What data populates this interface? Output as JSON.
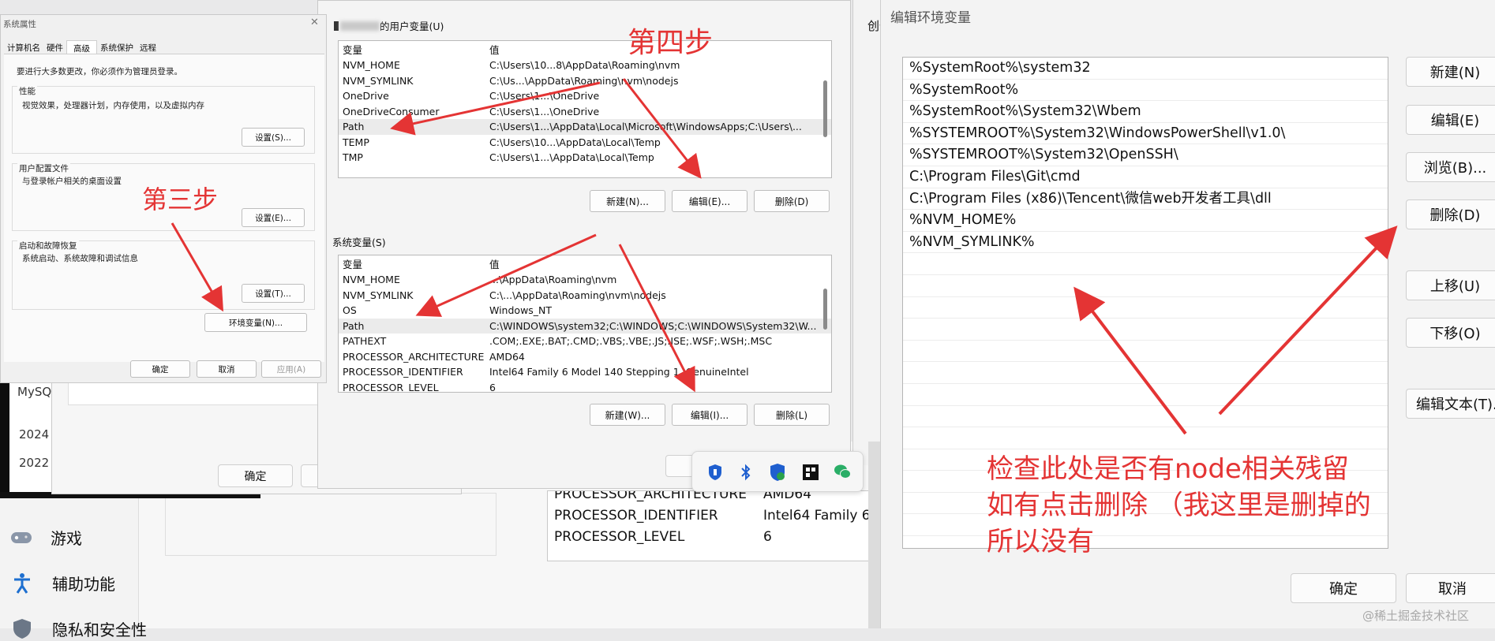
{
  "background": {
    "settings_sidebar": [
      {
        "icon": "gamepad-icon",
        "label": "游戏"
      },
      {
        "icon": "accessibility-icon",
        "label": "辅助功能"
      },
      {
        "icon": "shield-icon",
        "label": "隐私和安全性"
      }
    ],
    "left_fragments": [
      "MySQ",
      "2024",
      "2022"
    ],
    "behind_ok": "确定",
    "create_label": "创作",
    "behind_table": [
      {
        "name": "PROCESSOR_ARCHITECTURE",
        "value": "AMD64"
      },
      {
        "name": "PROCESSOR_IDENTIFIER",
        "value": "Intel64 Family 6 I"
      },
      {
        "name": "PROCESSOR_LEVEL",
        "value": "6"
      }
    ]
  },
  "sysprops": {
    "title": "系统属性",
    "tabs": [
      "计算机名",
      "硬件",
      "高级",
      "系统保护",
      "远程"
    ],
    "admin_note": "要进行大多数更改，你必须作为管理员登录。",
    "perf": {
      "title": "性能",
      "desc": "视觉效果，处理器计划，内存使用，以及虚拟内存",
      "button": "设置(S)..."
    },
    "profile": {
      "title": "用户配置文件",
      "desc": "与登录帐户相关的桌面设置",
      "button": "设置(E)..."
    },
    "startup": {
      "title": "启动和故障恢复",
      "desc": "系统启动、系统故障和调试信息",
      "button": "设置(T)..."
    },
    "env_button": "环境变量(N)...",
    "ok": "确定",
    "cancel": "取消",
    "apply": "应用(A)"
  },
  "envvars": {
    "user_label_suffix": "的用户变量(U)",
    "col_var": "变量",
    "col_val": "值",
    "user_vars": [
      {
        "name": "NVM_HOME",
        "value": "C:\\Users\\10...8\\AppData\\Roaming\\nvm"
      },
      {
        "name": "NVM_SYMLINK",
        "value": "C:\\Us...\\AppData\\Roaming\\nvm\\nodejs"
      },
      {
        "name": "OneDrive",
        "value": "C:\\Users\\1...\\OneDrive"
      },
      {
        "name": "OneDriveConsumer",
        "value": "C:\\Users\\1...\\OneDrive"
      },
      {
        "name": "Path",
        "value": "C:\\Users\\1...\\AppData\\Local\\Microsoft\\WindowsApps;C:\\Users\\..."
      },
      {
        "name": "TEMP",
        "value": "C:\\Users\\10...\\AppData\\Local\\Temp"
      },
      {
        "name": "TMP",
        "value": "C:\\Users\\1...\\AppData\\Local\\Temp"
      }
    ],
    "user_buttons": [
      "新建(N)...",
      "编辑(E)...",
      "删除(D)"
    ],
    "sys_label": "系统变量(S)",
    "sys_vars": [
      {
        "name": "NVM_HOME",
        "value": "...\\AppData\\Roaming\\nvm"
      },
      {
        "name": "NVM_SYMLINK",
        "value": "C:\\...\\AppData\\Roaming\\nvm\\nodejs"
      },
      {
        "name": "OS",
        "value": "Windows_NT"
      },
      {
        "name": "Path",
        "value": "C:\\WINDOWS\\system32;C:\\WINDOWS;C:\\WINDOWS\\System32\\W..."
      },
      {
        "name": "PATHEXT",
        "value": ".COM;.EXE;.BAT;.CMD;.VBS;.VBE;.JS;.JSE;.WSF;.WSH;.MSC"
      },
      {
        "name": "PROCESSOR_ARCHITECTURE",
        "value": "AMD64"
      },
      {
        "name": "PROCESSOR_IDENTIFIER",
        "value": "Intel64 Family 6 Model 140 Stepping 1, GenuineIntel"
      },
      {
        "name": "PROCESSOR_LEVEL",
        "value": "6"
      }
    ],
    "sys_buttons": [
      "新建(W)...",
      "编辑(I)...",
      "删除(L)"
    ]
  },
  "editenv": {
    "title": "编辑环境变量",
    "entries": [
      "%SystemRoot%\\system32",
      "%SystemRoot%",
      "%SystemRoot%\\System32\\Wbem",
      "%SYSTEMROOT%\\System32\\WindowsPowerShell\\v1.0\\",
      "%SYSTEMROOT%\\System32\\OpenSSH\\",
      "C:\\Program Files\\Git\\cmd",
      "C:\\Program Files (x86)\\Tencent\\微信web开发者工具\\dll",
      "%NVM_HOME%",
      "%NVM_SYMLINK%"
    ],
    "buttons": [
      "新建(N)",
      "编辑(E)",
      "浏览(B)...",
      "删除(D)",
      "上移(U)",
      "下移(O)",
      "编辑文本(T)..."
    ],
    "ok": "确定",
    "cancel": "取消"
  },
  "annotations": {
    "step3": "第三步",
    "step4": "第四步",
    "note_lines": [
      "检查此处是否有node相关残留",
      "如有点击删除 （我这里是删掉的",
      "所以没有"
    ]
  },
  "tray_icons": [
    "defender-icon",
    "bluetooth-icon",
    "security-icon",
    "app-icon",
    "wechat-icon"
  ],
  "watermark": "@稀土掘金技术社区",
  "colors": {
    "annotation_red": "#e43434",
    "accent": "#1f5fcf"
  }
}
